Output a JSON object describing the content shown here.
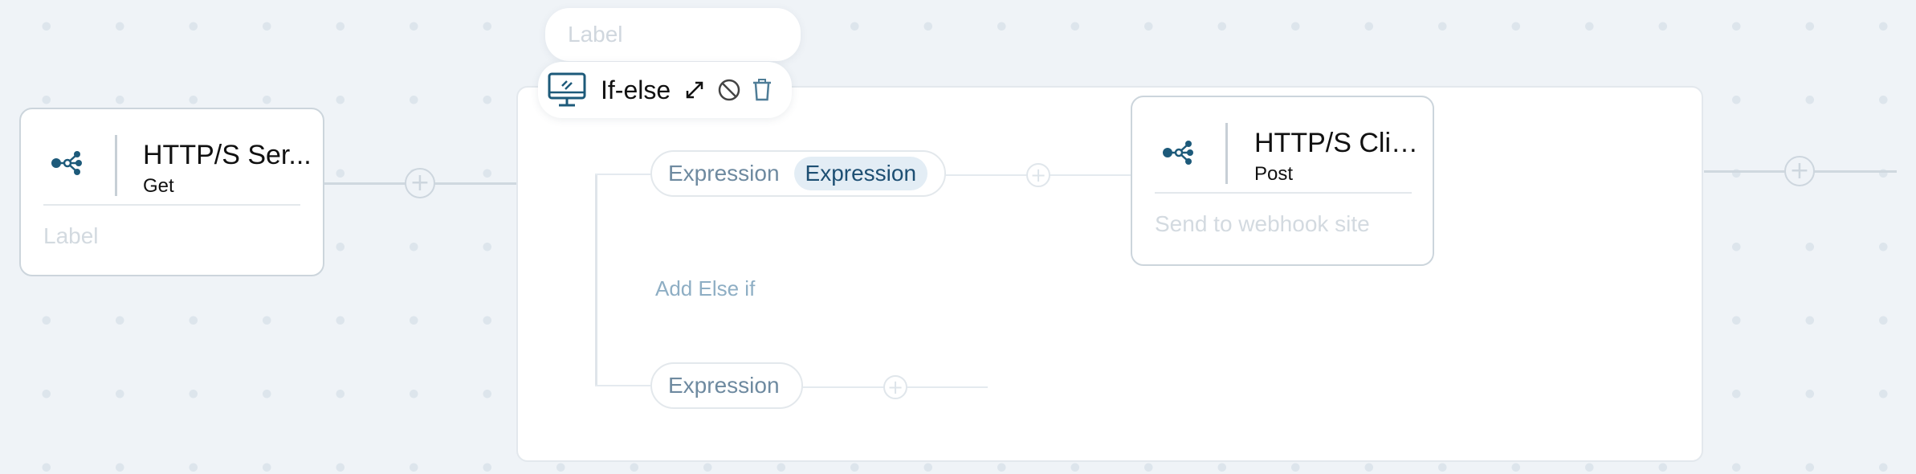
{
  "canvas": {
    "label_placeholder": "Label"
  },
  "nodes": {
    "server": {
      "title": "HTTP/S Ser...",
      "method": "Get",
      "label": "Label",
      "icon": "share-nodes-icon"
    },
    "client": {
      "title": "HTTP/S Clie...",
      "method": "Post",
      "label": "Send to webhook site",
      "icon": "share-nodes-icon"
    }
  },
  "ifelse": {
    "title": "If-else",
    "icons": [
      "monitor-icon",
      "expand-icon",
      "disable-icon",
      "trash-icon"
    ],
    "branches": {
      "if_chips": [
        "Expression",
        "Expression"
      ],
      "add_else_if": "Add Else if",
      "else_chip": "Expression"
    }
  },
  "add_symbol": "+",
  "colors": {
    "background": "#eff3f7",
    "accent": "#1d5a7a",
    "connector": "#cfd8df",
    "muted_link": "#8eaec4"
  }
}
